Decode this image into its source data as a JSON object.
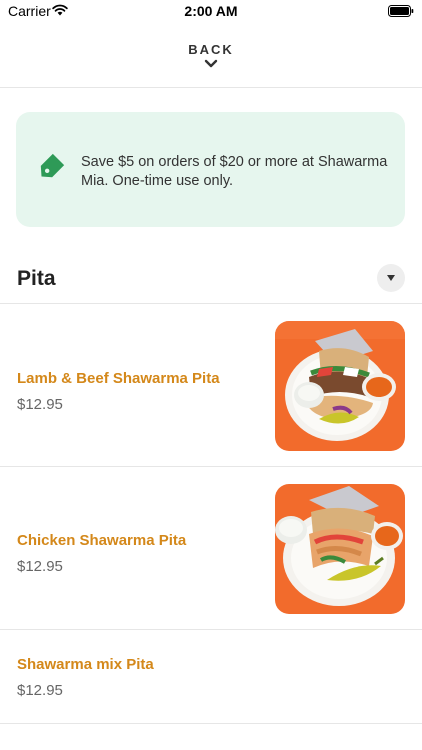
{
  "status_bar": {
    "carrier": "Carrier",
    "time": "2:00 AM"
  },
  "nav": {
    "back_label": "BACK"
  },
  "promo": {
    "text": "Save $5 on orders of $20 or more at Shawarma Mia. One-time use only.",
    "color": "#2e9a57"
  },
  "section": {
    "title": "Pita"
  },
  "items": [
    {
      "name": "Lamb & Beef Shawarma Pita",
      "price": "$12.95"
    },
    {
      "name": "Chicken Shawarma Pita",
      "price": "$12.95"
    },
    {
      "name": "Shawarma mix Pita",
      "price": "$12.95"
    }
  ],
  "colors": {
    "accent": "#d4881a",
    "promo_bg": "#e6f6ee"
  }
}
